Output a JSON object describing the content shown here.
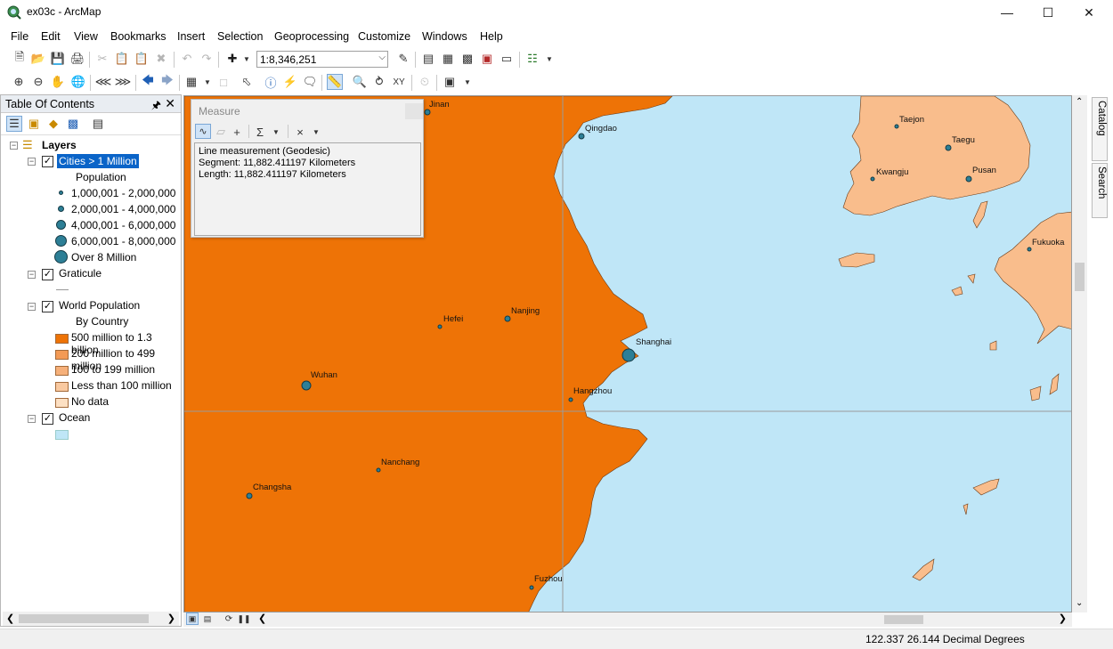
{
  "window": {
    "title": "ex03c - ArcMap"
  },
  "menu": [
    "File",
    "Edit",
    "View",
    "Bookmarks",
    "Insert",
    "Selection",
    "Geoprocessing",
    "Customize",
    "Windows",
    "Help"
  ],
  "toolbar": {
    "scale": "1:8,346,251"
  },
  "toc": {
    "title": "Table Of Contents",
    "root": "Layers",
    "cities": {
      "name": "Cities > 1 Million",
      "field": "Population",
      "classes": [
        "1,000,001 - 2,000,000",
        "2,000,001 - 4,000,000",
        "4,000,001 - 6,000,000",
        "6,000,001 - 8,000,000",
        "Over 8 Million"
      ]
    },
    "graticule": {
      "name": "Graticule"
    },
    "world": {
      "name": "World Population",
      "field": "By Country",
      "classes": [
        "500 million to 1.3 billion",
        "200 million to 499 million",
        "100 to 199 million",
        "Less than 100 million",
        "No data"
      ],
      "colors": [
        "#ee7306",
        "#f39a55",
        "#f6b07a",
        "#f9c9a0",
        "#fde0c3"
      ]
    },
    "ocean": {
      "name": "Ocean",
      "color": "#bfe6f7"
    }
  },
  "measure": {
    "title": "Measure",
    "line1": "Line measurement (Geodesic)",
    "line2": "Segment: 11,882.411197 Kilometers",
    "line3": "Length: 11,882.411197 Kilometers"
  },
  "map": {
    "colors": {
      "land_china": "#ee7306",
      "land_other": "#f9bd8c",
      "ocean": "#bfe6f7",
      "outline": "#6b3a15",
      "city": "#2d7f96"
    },
    "cities": [
      "Jinan",
      "Qingdao",
      "Nanjing",
      "Hefei",
      "Shanghai",
      "Wuhan",
      "Hangzhou",
      "Nanchang",
      "Changsha",
      "Fuzhou",
      "Taejon",
      "Taegu",
      "Kwangju",
      "Pusan",
      "Fukuoka"
    ]
  },
  "dock": {
    "catalog": "Catalog",
    "search": "Search"
  },
  "status": {
    "coordinates": "122.337  26.144 Decimal Degrees"
  }
}
